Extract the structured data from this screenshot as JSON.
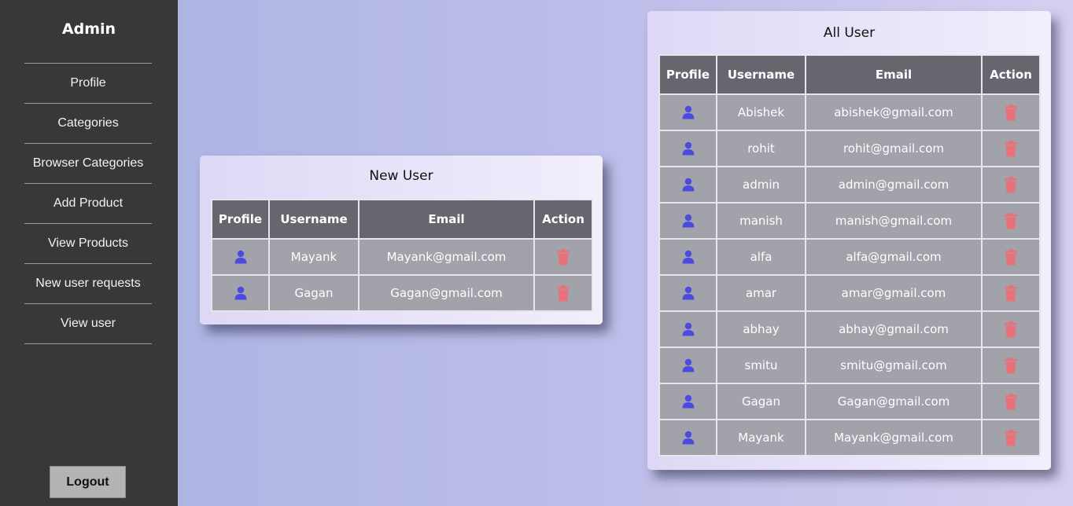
{
  "sidebar": {
    "title": "Admin",
    "items": [
      {
        "label": "Profile"
      },
      {
        "label": "Categories"
      },
      {
        "label": "Browser Categories"
      },
      {
        "label": "Add Product"
      },
      {
        "label": "View Products"
      },
      {
        "label": "New user requests"
      },
      {
        "label": "View user"
      }
    ],
    "logout_label": "Logout"
  },
  "new_user": {
    "title": "New User",
    "columns": [
      "Profile",
      "Username",
      "Email",
      "Action"
    ],
    "rows": [
      {
        "username": "Mayank",
        "email": "Mayank@gmail.com"
      },
      {
        "username": "Gagan",
        "email": "Gagan@gmail.com"
      }
    ]
  },
  "all_user": {
    "title": "All User",
    "columns": [
      "Profile",
      "Username",
      "Email",
      "Action"
    ],
    "rows": [
      {
        "username": "Abishek",
        "email": "abishek@gmail.com"
      },
      {
        "username": "rohit",
        "email": "rohit@gmail.com"
      },
      {
        "username": "admin",
        "email": "admin@gmail.com"
      },
      {
        "username": "manish",
        "email": "manish@gmail.com"
      },
      {
        "username": "alfa",
        "email": "alfa@gmail.com"
      },
      {
        "username": "amar",
        "email": "amar@gmail.com"
      },
      {
        "username": "abhay",
        "email": "abhay@gmail.com"
      },
      {
        "username": "smitu",
        "email": "smitu@gmail.com"
      },
      {
        "username": "Gagan",
        "email": "Gagan@gmail.com"
      },
      {
        "username": "Mayank",
        "email": "Mayank@gmail.com"
      }
    ]
  },
  "icons": {
    "profile": "user-icon",
    "action": "trash-icon"
  },
  "colors": {
    "user_icon": "#4b4be0",
    "trash_icon": "#e8727a",
    "sidebar_bg": "#383838",
    "header_bg": "#65666e",
    "cell_bg": "#a1a2aa"
  }
}
